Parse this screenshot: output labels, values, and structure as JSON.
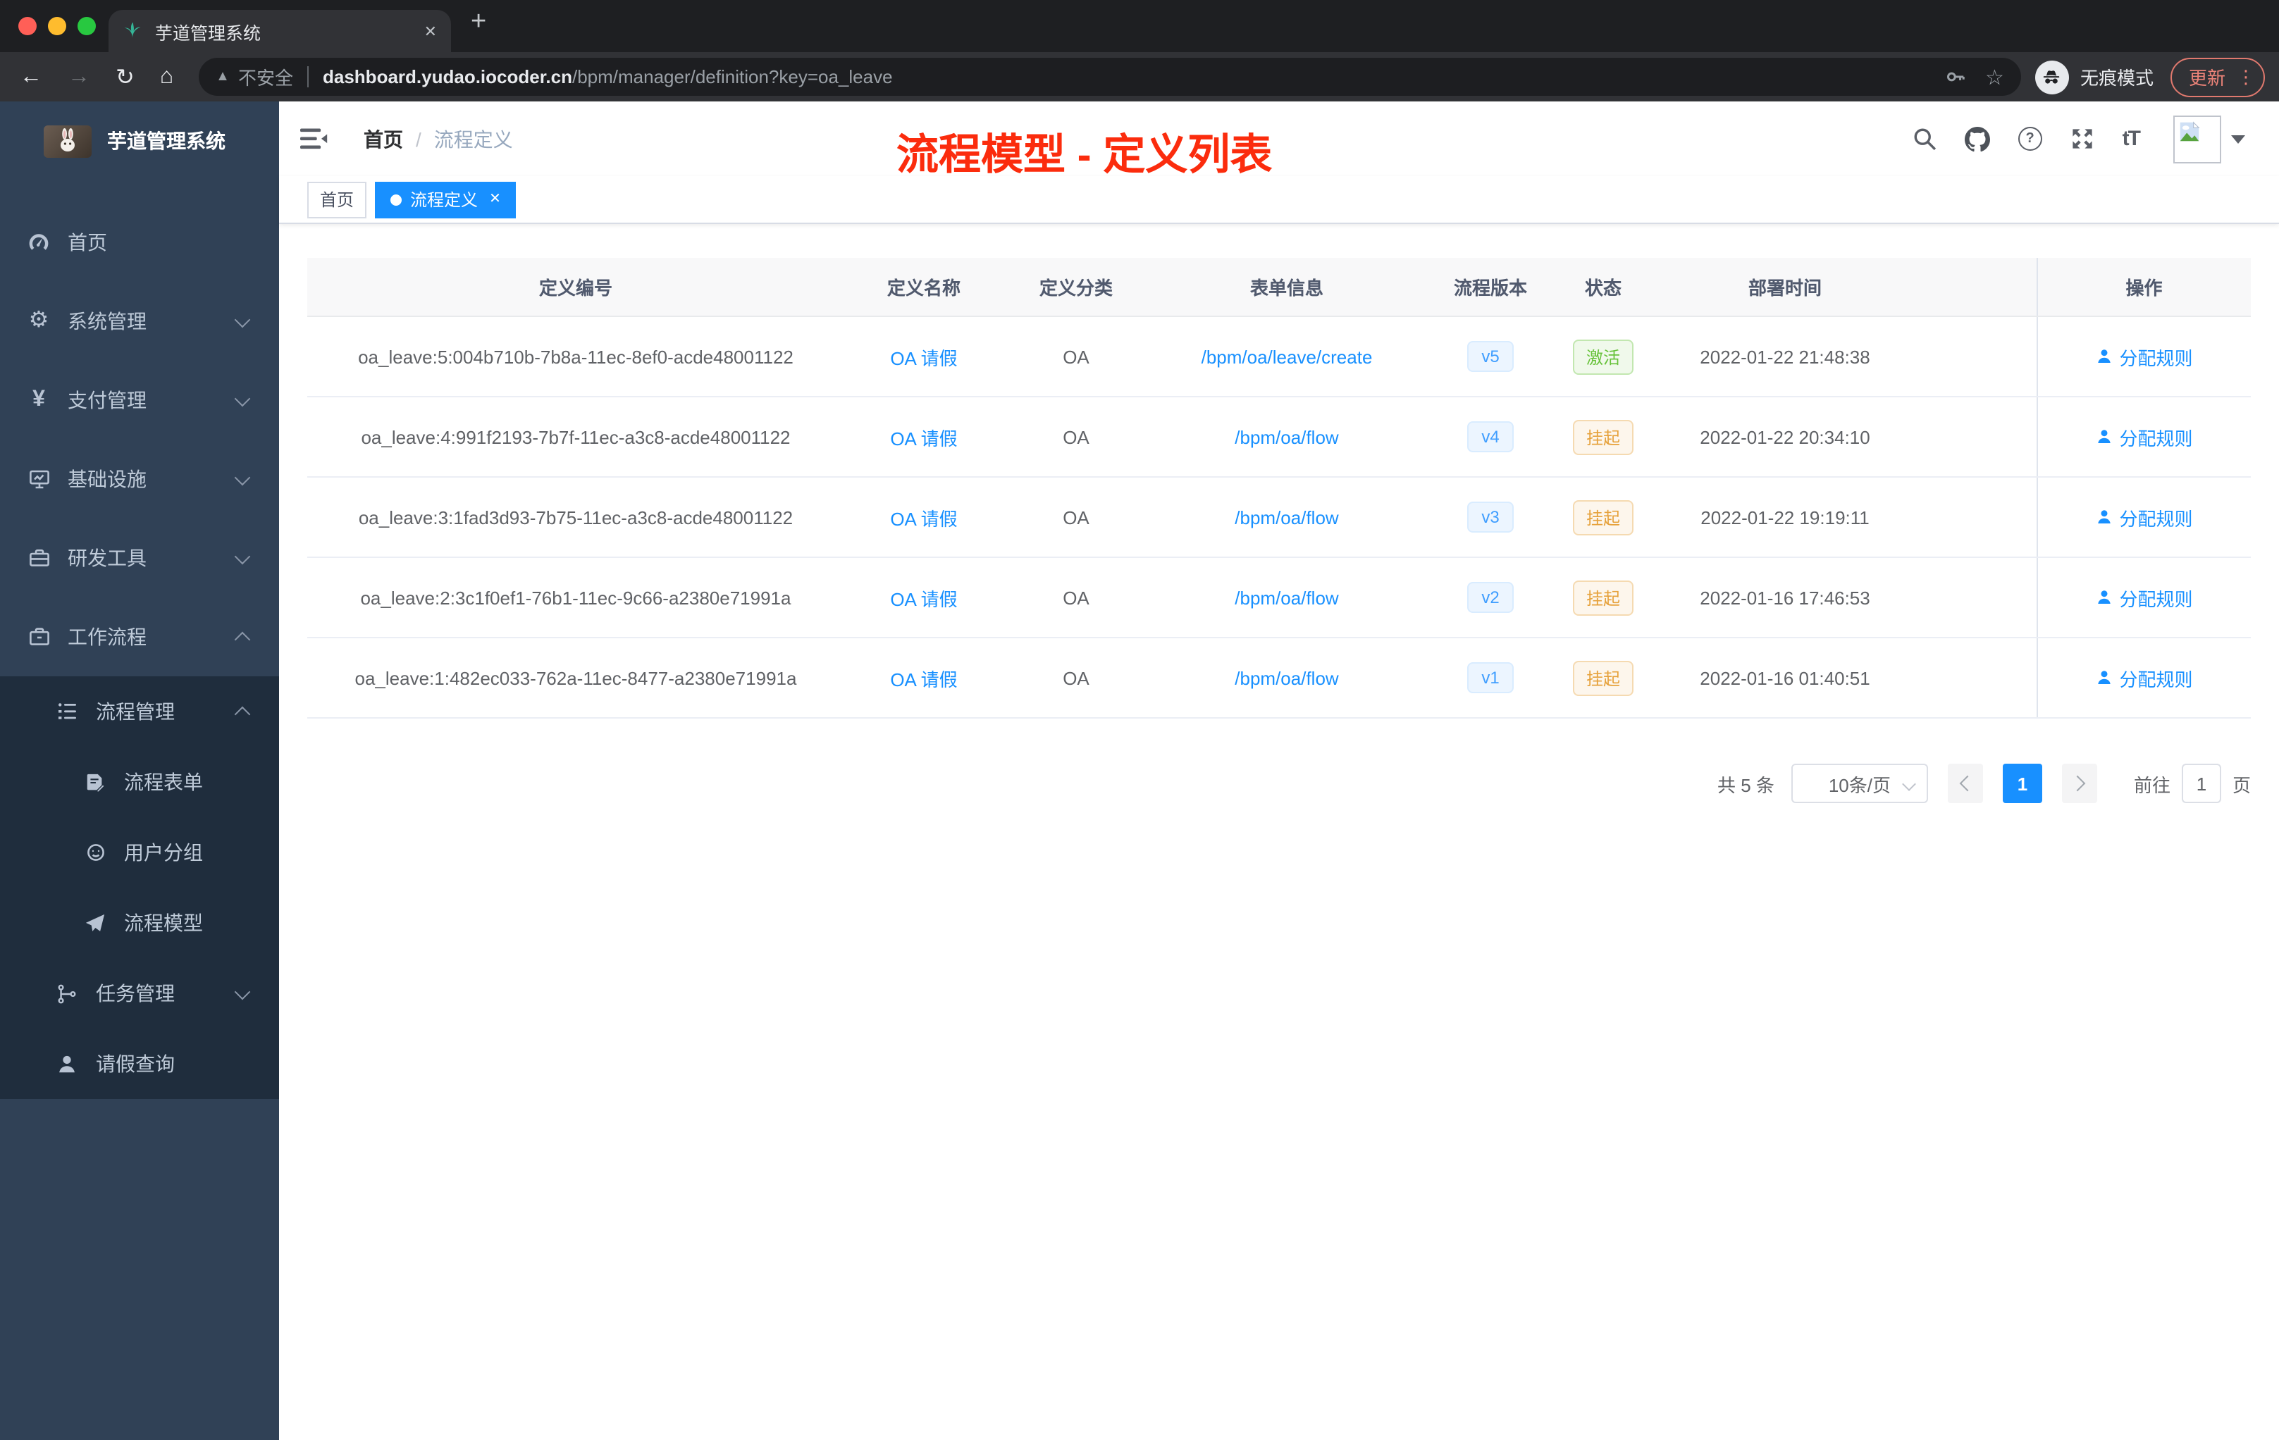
{
  "browser": {
    "tab_title": "芋道管理系统",
    "security_label": "不安全",
    "url_host": "dashboard.yudao.iocoder.cn",
    "url_path": "/bpm/manager/definition?key=oa_leave",
    "incognito_label": "无痕模式",
    "update_label": "更新"
  },
  "icons": {
    "back": "←",
    "forward": "→",
    "refresh": "↻",
    "home": "⌂",
    "star": "☆",
    "warning": "▲",
    "more_vertical": "⋮",
    "new_tab": "+",
    "close_tab": "✕",
    "close_tag": "✕",
    "gear": "⚙",
    "yen": "¥",
    "question": "?",
    "font_size": "tT",
    "breadcrumb_separator": "/"
  },
  "sidebar": {
    "logo_title": "芋道管理系统",
    "items": [
      {
        "label": "首页"
      },
      {
        "label": "系统管理"
      },
      {
        "label": "支付管理"
      },
      {
        "label": "基础设施"
      },
      {
        "label": "研发工具"
      },
      {
        "label": "工作流程"
      },
      {
        "label": "流程管理"
      },
      {
        "label": "流程表单"
      },
      {
        "label": "用户分组"
      },
      {
        "label": "流程模型"
      },
      {
        "label": "任务管理"
      },
      {
        "label": "请假查询"
      }
    ]
  },
  "header": {
    "breadcrumb": [
      "首页",
      "流程定义"
    ],
    "annotation": "流程模型 - 定义列表"
  },
  "tags_view": [
    {
      "label": "首页"
    },
    {
      "label": "流程定义"
    }
  ],
  "table": {
    "columns": [
      "定义编号",
      "定义名称",
      "定义分类",
      "表单信息",
      "流程版本",
      "状态",
      "部署时间",
      "操作"
    ],
    "action_label": "分配规则",
    "rows": [
      {
        "id": "oa_leave:5:004b710b-7b8a-11ec-8ef0-acde48001122",
        "name": "OA 请假",
        "category": "OA",
        "form": "/bpm/oa/leave/create",
        "version": "v5",
        "status": "激活",
        "deployed_at": "2022-01-22 21:48:38"
      },
      {
        "id": "oa_leave:4:991f2193-7b7f-11ec-a3c8-acde48001122",
        "name": "OA 请假",
        "category": "OA",
        "form": "/bpm/oa/flow",
        "version": "v4",
        "status": "挂起",
        "deployed_at": "2022-01-22 20:34:10"
      },
      {
        "id": "oa_leave:3:1fad3d93-7b75-11ec-a3c8-acde48001122",
        "name": "OA 请假",
        "category": "OA",
        "form": "/bpm/oa/flow",
        "version": "v3",
        "status": "挂起",
        "deployed_at": "2022-01-22 19:19:11"
      },
      {
        "id": "oa_leave:2:3c1f0ef1-76b1-11ec-9c66-a2380e71991a",
        "name": "OA 请假",
        "category": "OA",
        "form": "/bpm/oa/flow",
        "version": "v2",
        "status": "挂起",
        "deployed_at": "2022-01-16 17:46:53"
      },
      {
        "id": "oa_leave:1:482ec033-762a-11ec-8477-a2380e71991a",
        "name": "OA 请假",
        "category": "OA",
        "form": "/bpm/oa/flow",
        "version": "v1",
        "status": "挂起",
        "deployed_at": "2022-01-16 01:40:51"
      }
    ]
  },
  "pagination": {
    "total": "共 5 条",
    "page_size": "10条/页",
    "current_page": "1",
    "goto_label": "前往",
    "goto_value": "1",
    "page_unit": "页"
  },
  "colors": {
    "accent_blue": "#1890ff",
    "version_tag_text": "#409eff",
    "status_active_green": "#67c23a",
    "status_suspended_orange": "#e6a23c",
    "annotation_red": "#fb2c0d",
    "sidebar_bg": "#304156",
    "sidebar_submenu_bg": "#1f2d3d",
    "update_button": "#ec8378"
  }
}
